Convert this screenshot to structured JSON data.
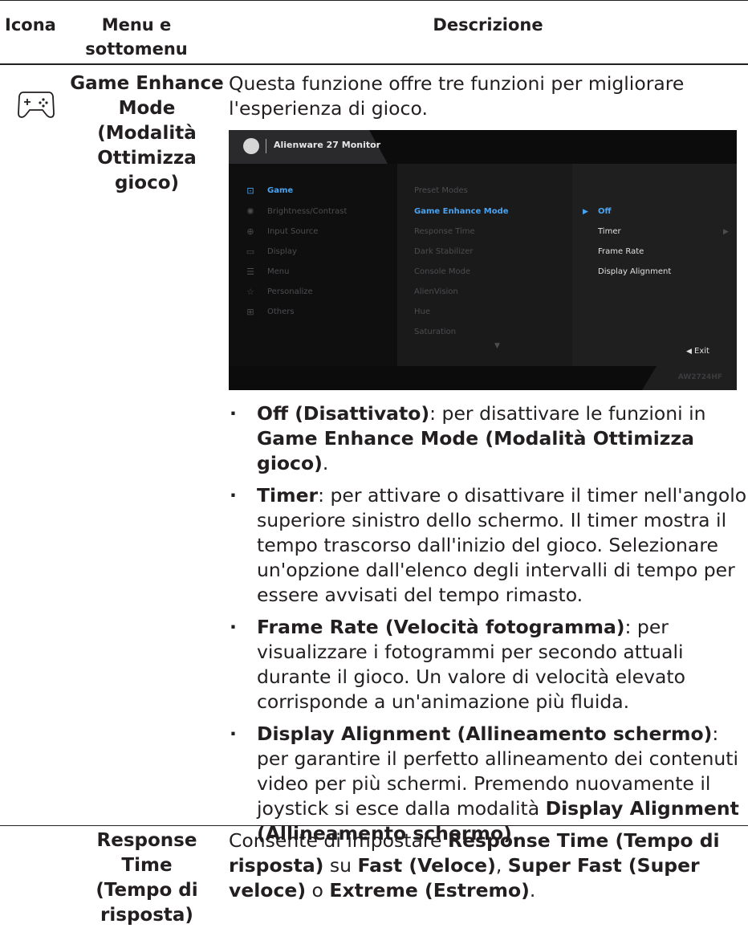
{
  "headers": {
    "icon": "Icona",
    "menu": "Menu e sottomenu",
    "description": "Descrizione"
  },
  "rows": [
    {
      "icon": "gamepad-icon",
      "menu_lines": [
        "Game Enhance",
        "Mode",
        "(Modalità",
        "Ottimizza",
        "gioco)"
      ],
      "intro": "Questa funzione offre tre funzioni per migliorare l'esperienza di gioco.",
      "bullets": [
        {
          "bold": "Off (Disattivato)",
          "text_a": ": per disattivare le funzioni in ",
          "bold2": "Game Enhance Mode (Modalità Ottimizza gioco)",
          "text_b": "."
        },
        {
          "bold": "Timer",
          "text_a": ": per attivare o disattivare il timer nell'angolo superiore sinistro dello schermo. Il timer mostra il tempo trascorso dall'inizio del gioco. Selezionare un'opzione dall'elenco degli intervalli di tempo per essere avvisati del tempo rimasto.",
          "bold2": "",
          "text_b": ""
        },
        {
          "bold": "Frame Rate (Velocità fotogramma)",
          "text_a": ": per visualizzare i fotogrammi per secondo attuali durante il gioco. Un valore di velocità elevato corrisponde a un'animazione più fluida.",
          "bold2": "",
          "text_b": ""
        },
        {
          "bold": "Display Alignment (Allineamento schermo)",
          "text_a": ": per garantire il perfetto allineamento dei contenuti video per più schermi. Premendo nuovamente il joystick si esce dalla modalità ",
          "bold2": "Display Alignment (Allineamento schermo)",
          "text_b": "."
        }
      ]
    },
    {
      "menu_lines": [
        "Response Time",
        "(Tempo di",
        "risposta)"
      ],
      "desc": {
        "t1": "Consente di impostare ",
        "b1": "Response Time (Tempo di risposta)",
        "t2": " su ",
        "b2": "Fast (Veloce)",
        "t3": ", ",
        "b3": "Super Fast (Super veloce)",
        "t4": " o ",
        "b4": "Extreme (Estremo)",
        "t5": "."
      }
    }
  ],
  "osd": {
    "title": "Alienware 27 Monitor",
    "model": "AW2724HF",
    "main_menu": [
      {
        "label": "Game",
        "icon": "gamepad-icon",
        "active": true
      },
      {
        "label": "Brightness/Contrast",
        "icon": "brightness-icon",
        "active": false
      },
      {
        "label": "Input Source",
        "icon": "input-source-icon",
        "active": false
      },
      {
        "label": "Display",
        "icon": "display-icon",
        "active": false
      },
      {
        "label": "Menu",
        "icon": "menu-icon",
        "active": false
      },
      {
        "label": "Personalize",
        "icon": "star-icon",
        "active": false
      },
      {
        "label": "Others",
        "icon": "others-icon",
        "active": false
      }
    ],
    "sub_menu": [
      "Preset Modes",
      "Game Enhance Mode",
      "Response Time",
      "Dark Stabilizer",
      "Console Mode",
      "AlienVision",
      "Hue",
      "Saturation"
    ],
    "options": [
      "Off",
      "Timer",
      "Frame Rate",
      "Display Alignment"
    ],
    "exit": "Exit",
    "colors": {
      "accent": "#4aa3f0",
      "background": "#1b1b1c"
    }
  }
}
